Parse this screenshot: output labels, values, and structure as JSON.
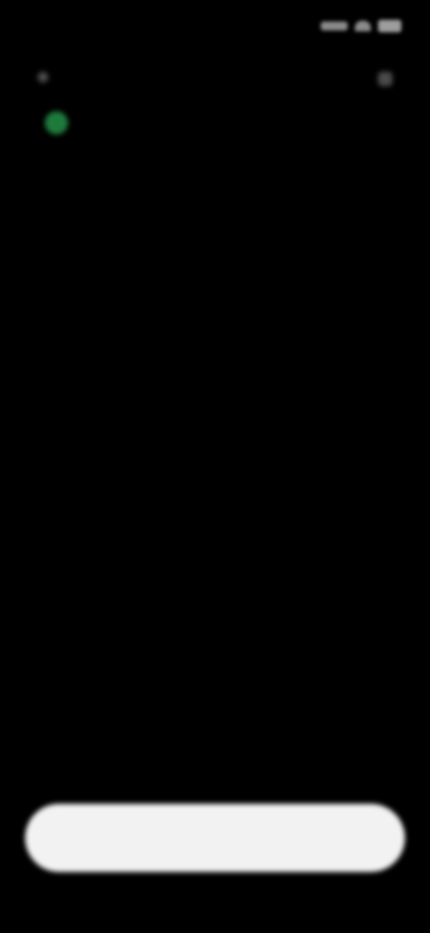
{
  "status_bar": {
    "time": "",
    "icons": [
      "signal-icon",
      "wifi-icon",
      "battery-icon"
    ]
  },
  "header": {
    "title": "",
    "connection_indicator_color": "#1e7a3c"
  },
  "message": {
    "line1": "",
    "line2": "",
    "line3": ""
  },
  "primary_button": {
    "label": ""
  }
}
